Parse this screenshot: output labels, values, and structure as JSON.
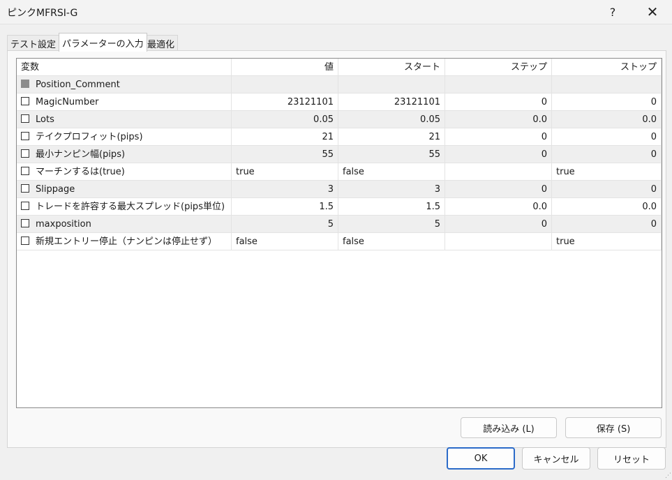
{
  "window": {
    "title": "ピンクMFRSI-G",
    "help_label": "?",
    "close_label": "✕"
  },
  "tabs": [
    {
      "label": "テスト設定"
    },
    {
      "label": "パラメーターの入力"
    },
    {
      "label": "最適化"
    }
  ],
  "table": {
    "headers": [
      "変数",
      "値",
      "スタート",
      "ステップ",
      "ストップ"
    ],
    "rows": [
      {
        "name": "Position_Comment",
        "value": "",
        "start": "",
        "step": "",
        "stop": "",
        "disabled": true
      },
      {
        "name": "MagicNumber",
        "value": "23121101",
        "start": "23121101",
        "step": "0",
        "stop": "0"
      },
      {
        "name": "Lots",
        "value": "0.05",
        "start": "0.05",
        "step": "0.0",
        "stop": "0.0"
      },
      {
        "name": "テイクプロフィット(pips)",
        "value": "21",
        "start": "21",
        "step": "0",
        "stop": "0"
      },
      {
        "name": "最小ナンピン幅(pips)",
        "value": "55",
        "start": "55",
        "step": "0",
        "stop": "0"
      },
      {
        "name": "マーチンするは(true)",
        "value": "true",
        "start": "false",
        "step": "",
        "stop": "true",
        "text": true
      },
      {
        "name": "Slippage",
        "value": "3",
        "start": "3",
        "step": "0",
        "stop": "0"
      },
      {
        "name": "トレードを許容する最大スプレッド(pips単位)",
        "value": "1.5",
        "start": "1.5",
        "step": "0.0",
        "stop": "0.0"
      },
      {
        "name": "maxposition",
        "value": "5",
        "start": "5",
        "step": "0",
        "stop": "0"
      },
      {
        "name": "新規エントリー停止（ナンピンは停止せず）",
        "value": "false",
        "start": "false",
        "step": "",
        "stop": "true",
        "text": true
      }
    ]
  },
  "buttons": {
    "load": "読み込み (L)",
    "save": "保存 (S)",
    "ok": "OK",
    "cancel": "キャンセル",
    "reset": "リセット"
  }
}
